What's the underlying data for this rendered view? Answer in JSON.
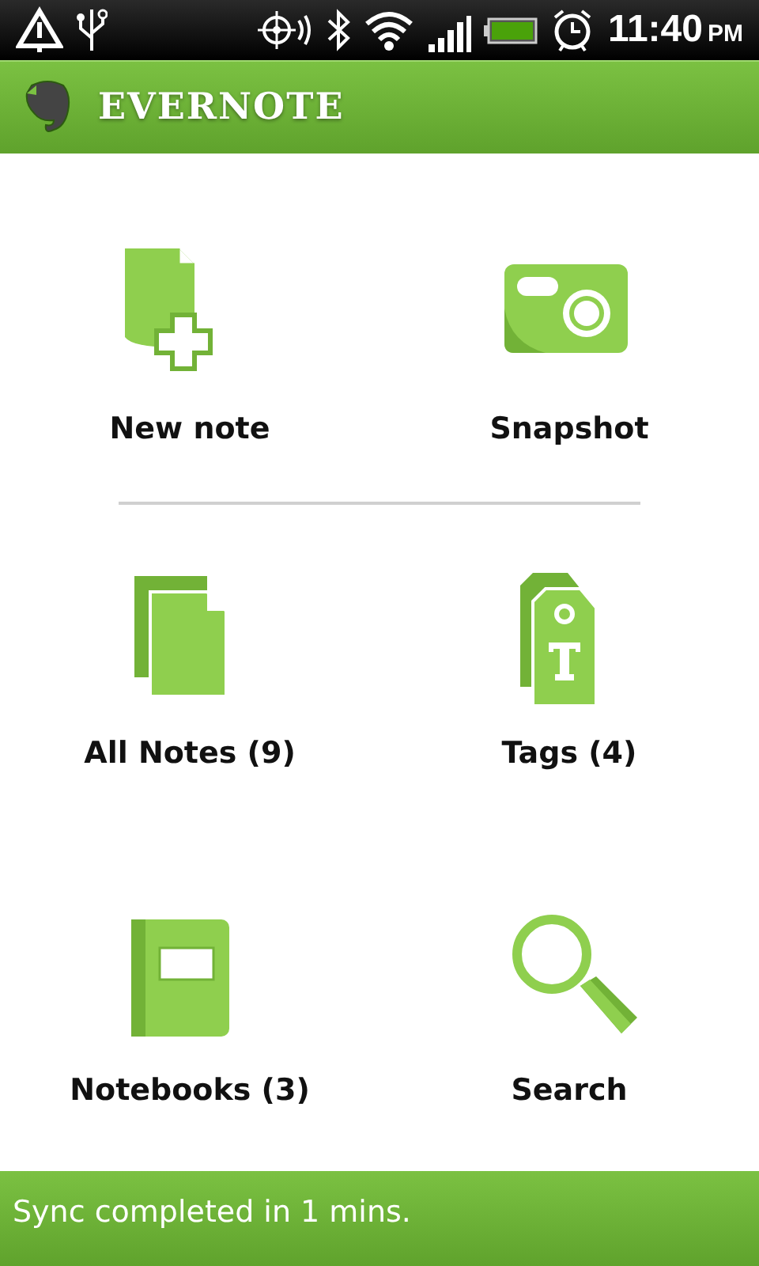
{
  "status_bar": {
    "time": "11:40",
    "meridiem": "PM"
  },
  "app_bar": {
    "title": "EVERNOTE"
  },
  "rows": [
    {
      "divider_below": true,
      "items": [
        {
          "kind": "new_note",
          "label": "New note"
        },
        {
          "kind": "snapshot",
          "label": "Snapshot"
        }
      ]
    },
    {
      "divider_below": false,
      "items": [
        {
          "kind": "all_notes",
          "label": "All Notes (9)"
        },
        {
          "kind": "tags",
          "label": "Tags (4)"
        }
      ]
    },
    {
      "divider_below": false,
      "items": [
        {
          "kind": "notebooks",
          "label": "Notebooks (3)"
        },
        {
          "kind": "search",
          "label": "Search"
        }
      ]
    }
  ],
  "footer": {
    "message": "Sync completed in 1 mins."
  }
}
